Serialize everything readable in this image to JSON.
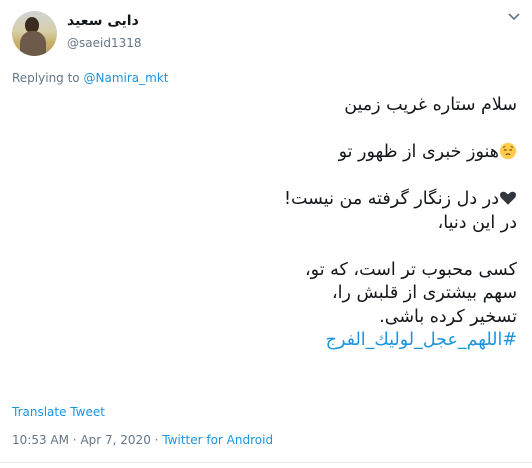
{
  "author": {
    "display_name": "دایی سعید",
    "handle": "@saeid1318"
  },
  "reply": {
    "prefix": "Replying to",
    "target": "@Namira_mkt"
  },
  "tweet": {
    "line1": "سلام ستاره غریب زمین",
    "line2": "هنوز خبری از ظهور تو",
    "line3": "در دل زنگار گرفته من نیست!",
    "line4": "در این دنیا،",
    "line5": "کسی محبوب تر است، که تو،",
    "line6": "سهم بیشتری از قلبش را،",
    "line7": "تسخیر کرده باشی.",
    "hashtag": "#اللهم_عجل_لوليك_الفرج"
  },
  "icons": {
    "line2_emoji": "pensive-face-icon",
    "line3_emoji": "black-heart-icon"
  },
  "translate_label": "Translate Tweet",
  "meta": {
    "time": "10:53 AM",
    "separator": "·",
    "date": "Apr 7, 2020",
    "source": "Twitter for Android"
  },
  "colors": {
    "link": "#1b95e0",
    "secondary_text": "#657786",
    "primary_text": "#14171a"
  }
}
